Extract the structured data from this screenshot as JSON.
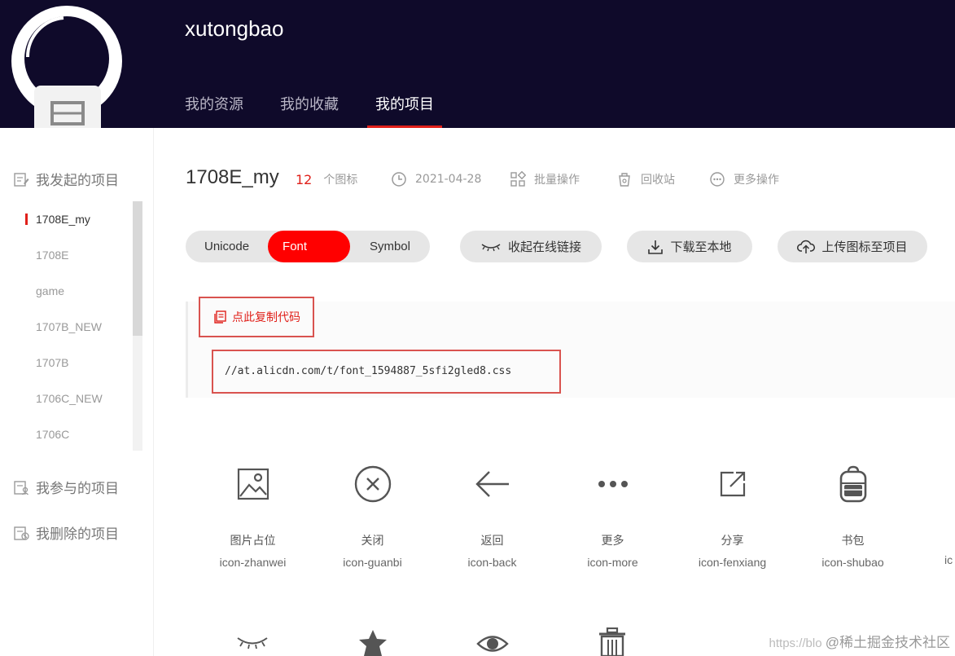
{
  "header": {
    "username": "xutongbao",
    "tabs": [
      {
        "label": "我的资源"
      },
      {
        "label": "我的收藏"
      },
      {
        "label": "我的项目"
      }
    ]
  },
  "sidebar": {
    "my_projects": "我发起的项目",
    "joined_projects": "我参与的项目",
    "deleted_projects": "我删除的项目",
    "items": [
      {
        "label": "1708E_my"
      },
      {
        "label": "1708E"
      },
      {
        "label": "game"
      },
      {
        "label": "1707B_NEW"
      },
      {
        "label": "1707B"
      },
      {
        "label": "1706C_NEW"
      },
      {
        "label": "1706C"
      }
    ]
  },
  "project": {
    "title": "1708E_my",
    "icon_count": "12",
    "icon_count_unit": "个图标",
    "date": "2021-04-28",
    "batch": "批量操作",
    "recycle": "回收站",
    "more": "更多操作"
  },
  "toolbar": {
    "segments": [
      "Unicode",
      "Font class",
      "Symbol"
    ],
    "collapse_link": "收起在线链接",
    "download": "下载至本地",
    "upload": "上传图标至项目"
  },
  "code": {
    "copy_label": "点此复制代码",
    "url": "//at.alicdn.com/t/font_1594887_5sfi2gled8.css"
  },
  "icons": [
    {
      "cn": "图片占位",
      "en": "icon-zhanwei",
      "icon": "image-placeholder-icon"
    },
    {
      "cn": "关闭",
      "en": "icon-guanbi",
      "icon": "close-circle-icon"
    },
    {
      "cn": "返回",
      "en": "icon-back",
      "icon": "arrow-left-icon"
    },
    {
      "cn": "更多",
      "en": "icon-more",
      "icon": "more-dots-icon"
    },
    {
      "cn": "分享",
      "en": "icon-fenxiang",
      "icon": "share-icon"
    },
    {
      "cn": "书包",
      "en": "icon-shubao",
      "icon": "backpack-icon"
    }
  ],
  "partial_next": "ic",
  "watermark": {
    "url": "https://blo",
    "brand": "@稀土掘金技术社区"
  },
  "colors": {
    "accent": "#ff0000",
    "header_bg": "#0f0a2a"
  }
}
